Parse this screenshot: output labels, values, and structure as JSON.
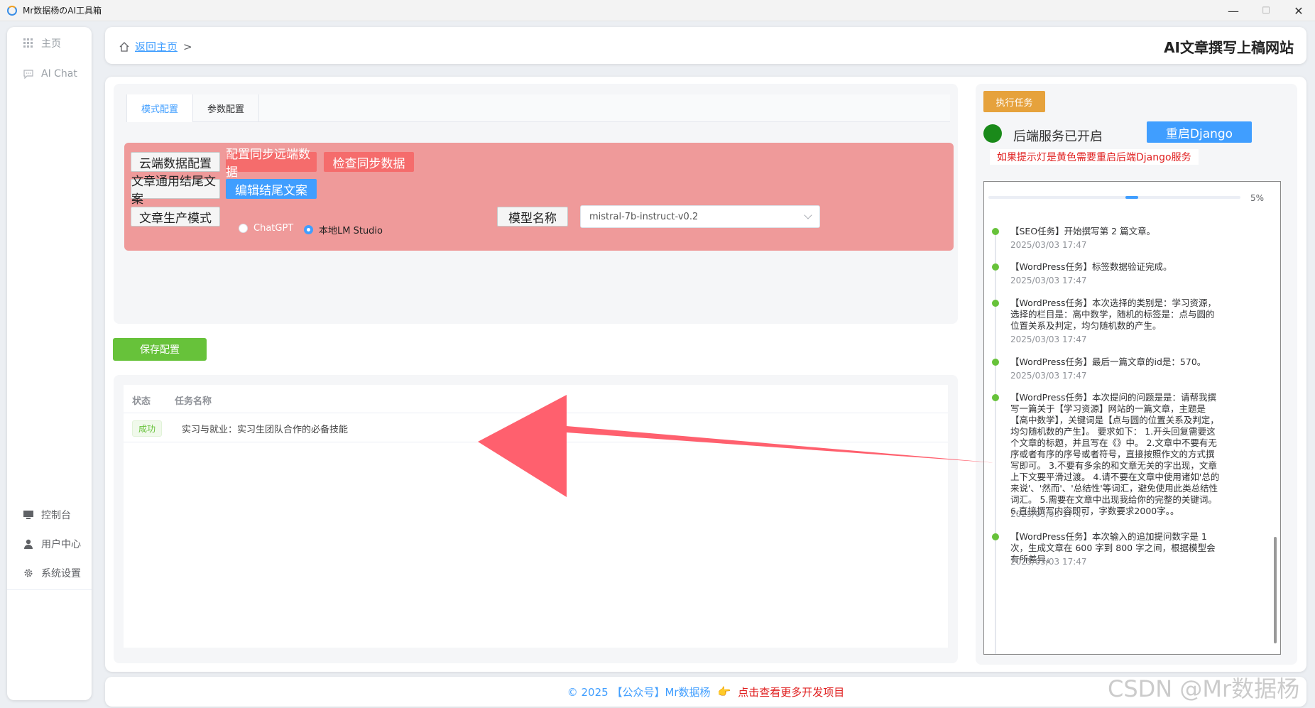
{
  "window": {
    "title": "Mr数据杨のAI工具箱"
  },
  "sidebar": {
    "top_items": [
      {
        "label": "主页"
      },
      {
        "label": "AI Chat"
      }
    ],
    "bottom_items": [
      {
        "label": "控制台"
      },
      {
        "label": "用户中心"
      },
      {
        "label": "系统设置"
      }
    ]
  },
  "header": {
    "breadcrumb_link": "返回主页",
    "breadcrumb_sep": ">",
    "site_title": "AI文章撰写上稿网站"
  },
  "config": {
    "tabs": [
      {
        "label": "模式配置",
        "active": true
      },
      {
        "label": "参数配置",
        "active": false
      }
    ],
    "buttons": {
      "cloud_config": "云端数据配置",
      "sync_remote": "配置同步远端数据",
      "check_sync": "检查同步数据",
      "ending_text": "文章通用结尾文案",
      "edit_ending": "编辑结尾文案",
      "mode_label": "文章生产模式",
      "model_label": "模型名称"
    },
    "mode_options": [
      {
        "label": "ChatGPT",
        "checked": false
      },
      {
        "label": "本地LM Studio",
        "checked": true
      }
    ],
    "model_value": "mistral-7b-instruct-v0.2",
    "save_label": "保存配置"
  },
  "tasks": {
    "columns": [
      "状态",
      "任务名称"
    ],
    "rows": [
      {
        "status": "成功",
        "name": "实习与就业：实习生团队合作的必备技能"
      }
    ]
  },
  "right": {
    "run_label": "执行任务",
    "status_text": "后端服务已开启",
    "status_color": "#1a8a1a",
    "restart_label": "重启Django",
    "warning": "如果提示灯是黄色需要重启后端Django服务",
    "progress_percent": 5,
    "progress_label": "5%",
    "logs": [
      {
        "text": "【SEO任务】开始撰写第 2 篇文章。",
        "time": "2025/03/03 17:47"
      },
      {
        "text": "【WordPress任务】标签数据验证完成。",
        "time": "2025/03/03 17:47"
      },
      {
        "text": "【WordPress任务】本次选择的类别是：学习资源，选择的栏目是：高中数学，随机的标签是：点与圆的位置关系及判定，均匀随机数的产生。",
        "time": "2025/03/03 17:47"
      },
      {
        "text": "【WordPress任务】最后一篇文章的id是：570。",
        "time": "2025/03/03 17:47"
      },
      {
        "text": "【WordPress任务】本次提问的问题是是：请帮我撰写一篇关于【学习资源】网站的一篇文章，主题是【高中数学】，关键词是【点与圆的位置关系及判定，均匀随机数的产生】。 要求如下： 1.开头回复需要这个文章的标题，并且写在《》中。 2.文章中不要有无序或者有序的序号或者符号，直接按照作文的方式撰写即可。 3.不要有多余的和文章无关的字出现，文章上下文要平滑过渡。 4.请不要在文章中使用诸如'总的来说'、'然而'、'总结性'等词汇，避免使用此类总结性词汇。 5.需要在文章中出现我给你的完整的关键词。 6.直接撰写内容即可，字数要求2000字。。",
        "time": "2025/03/03 17:47"
      },
      {
        "text": "【WordPress任务】本次输入的追加提问数字是 1 次，生成文章在 600 字到 800 字之间，根据模型会有所差异。",
        "time": "2025/03/03 17:47"
      }
    ]
  },
  "footer": {
    "copyright": "© 2025 【公众号】Mr数据杨",
    "hand_icon": "👉",
    "link": "点击查看更多开发项目"
  },
  "watermark": "CSDN @Mr数据杨",
  "colors": {
    "accent": "#409eff",
    "danger": "#f56c6c",
    "success": "#67c23a",
    "warning": "#e6a23c",
    "pink_panel": "#ef9a9a",
    "arrow": "#ff5262"
  }
}
